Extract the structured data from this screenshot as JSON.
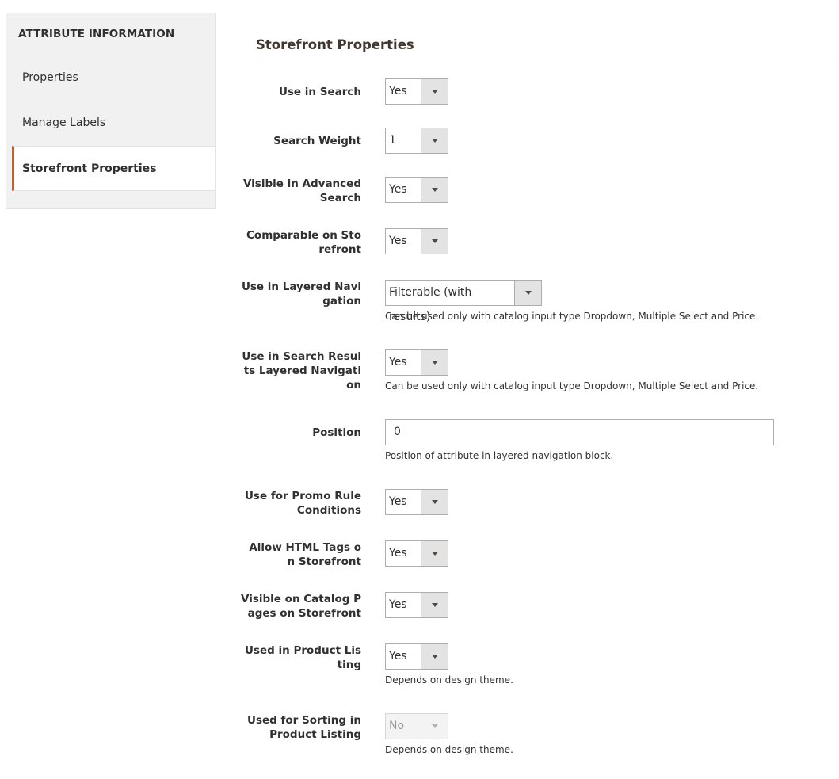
{
  "sidebar": {
    "title": "ATTRIBUTE INFORMATION",
    "items": [
      {
        "label": "Properties",
        "active": false
      },
      {
        "label": "Manage Labels",
        "active": false
      },
      {
        "label": "Storefront Properties",
        "active": true
      }
    ]
  },
  "section": {
    "title": "Storefront Properties"
  },
  "fields": {
    "use_in_search": {
      "label": "Use in Search",
      "value": "Yes"
    },
    "search_weight": {
      "label": "Search Weight",
      "value": "1"
    },
    "visible_advanced_search": {
      "label_line1": "Visible in Advanced",
      "label_line2": "Search",
      "value": "Yes"
    },
    "comparable": {
      "label_line1": "Comparable on Sto",
      "label_line2": "refront",
      "value": "Yes"
    },
    "layered_nav": {
      "label_line1": "Use in Layered Navi",
      "label_line2": "gation",
      "value": "Filterable (with results)",
      "note": "Can be used only with catalog input type Dropdown, Multiple Select and Price."
    },
    "search_results_layered_nav": {
      "label_line1": "Use in Search Resul",
      "label_line2": "ts Layered Navigati",
      "label_line3": "on",
      "value": "Yes",
      "note": "Can be used only with catalog input type Dropdown, Multiple Select and Price."
    },
    "position": {
      "label": "Position",
      "value": "0",
      "note": "Position of attribute in layered navigation block."
    },
    "promo_rules": {
      "label_line1": "Use for Promo Rule",
      "label_line2": "Conditions",
      "value": "Yes"
    },
    "html_tags": {
      "label_line1": "Allow HTML Tags o",
      "label_line2": "n Storefront",
      "value": "Yes"
    },
    "visible_catalog": {
      "label_line1": "Visible on Catalog P",
      "label_line2": "ages on Storefront",
      "value": "Yes"
    },
    "product_listing": {
      "label_line1": "Used in Product Lis",
      "label_line2": "ting",
      "value": "Yes",
      "note": "Depends on design theme."
    },
    "sorting": {
      "label_line1": "Used for Sorting in",
      "label_line2": "Product Listing",
      "value": "No",
      "disabled": true,
      "note": "Depends on design theme."
    }
  },
  "icons": {
    "dropdown": "caret-down-icon"
  },
  "colors": {
    "accent": "#eb5202",
    "select_button": "#e3e3e3",
    "rule": "#cac3b4"
  }
}
